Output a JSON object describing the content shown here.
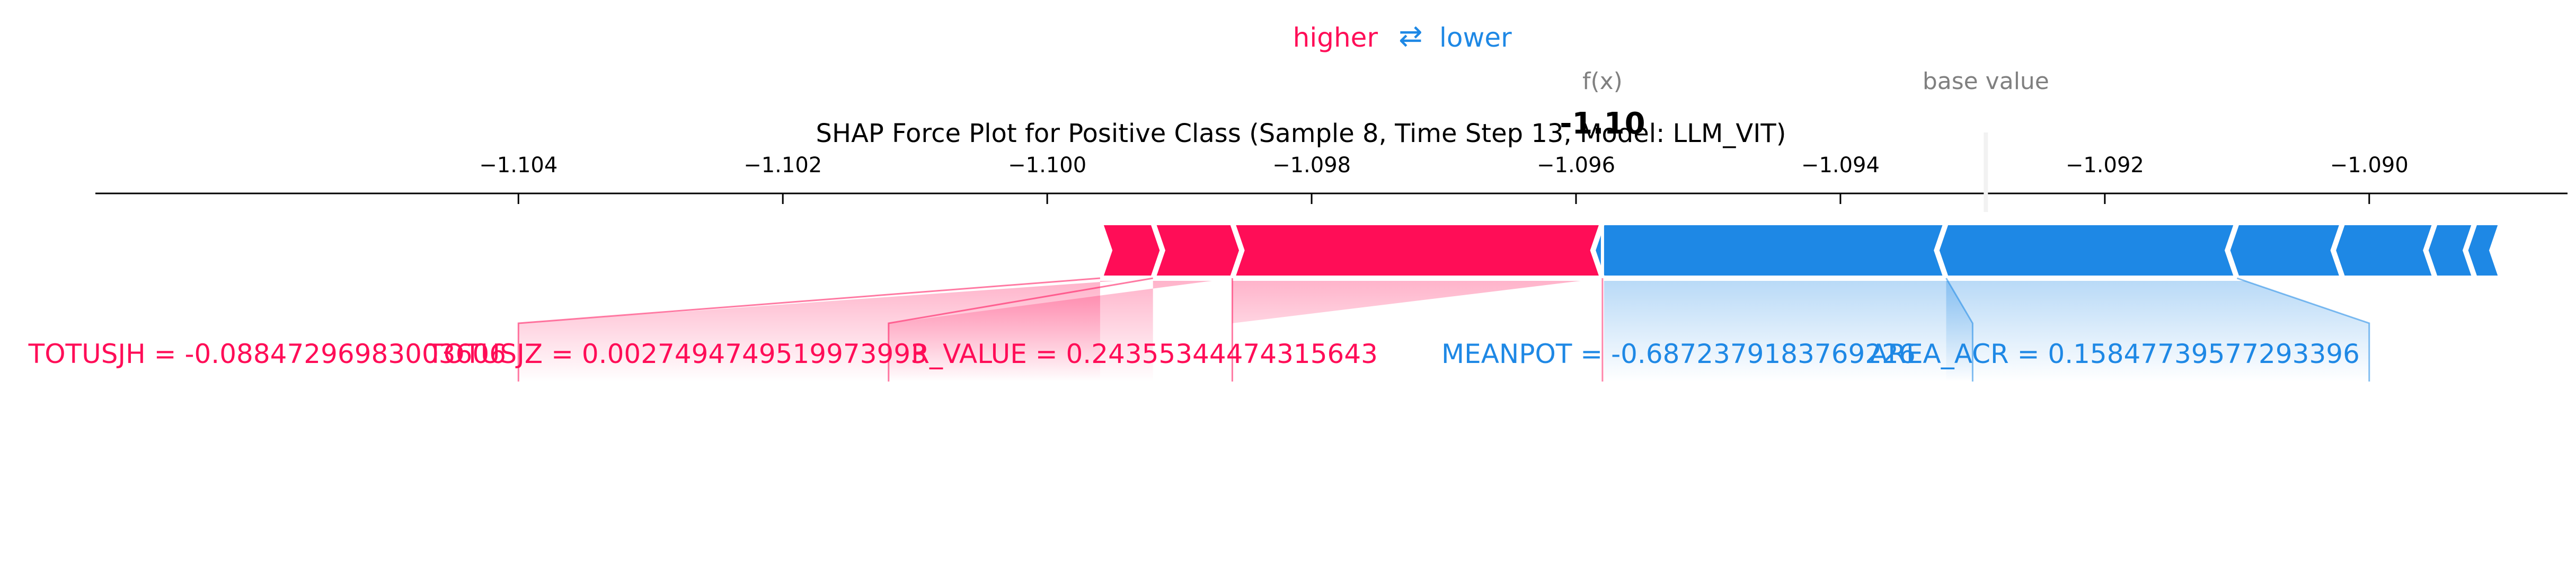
{
  "chart_data": {
    "type": "force",
    "title": "SHAP Force Plot for Positive Class (Sample 8, Time Step 13, Model: LLM_VIT)",
    "legend": {
      "higher": "higher",
      "arrow": "⇄",
      "lower": "lower"
    },
    "fx_label": "f(x)",
    "fx_value_text": "-1.10",
    "fx_value": -1.0958,
    "base_value_label": "base value",
    "base_value": -1.0929,
    "xlim": [
      -1.1072,
      -1.0885
    ],
    "ticks": [
      -1.104,
      -1.102,
      -1.1,
      -1.098,
      -1.096,
      -1.094,
      -1.092,
      -1.09
    ],
    "tick_labels": [
      "−1.104",
      "−1.102",
      "−1.100",
      "−1.098",
      "−1.096",
      "−1.094",
      "−1.092",
      "−1.090"
    ],
    "positive_features": [
      {
        "label": "TOTUSJH = -0.08847296983003606",
        "start": -1.0996,
        "end": -1.0992,
        "label_value": -1.104
      },
      {
        "label": "TOTUSJZ = 0.0027494749519973993",
        "start": -1.0992,
        "end": -1.0986,
        "label_value": -1.1012
      },
      {
        "label": "R_VALUE = 0.24355344474315643",
        "start": -1.0986,
        "end": -1.0958,
        "label_value": -1.0986
      }
    ],
    "negative_features": [
      {
        "label": "MEANPOT = -0.6872379183769226",
        "start": -1.0958,
        "end": -1.0932,
        "label_value": -1.093
      },
      {
        "label": "AREA_ACR = 0.15847739577293396",
        "start": -1.0932,
        "end": -1.091,
        "label_value": -1.09
      },
      {
        "label": "",
        "start": -1.091,
        "end": -1.0902,
        "label_value": null
      },
      {
        "label": "",
        "start": -1.0902,
        "end": -1.0895,
        "label_value": null
      },
      {
        "label": "",
        "start": -1.0895,
        "end": -1.0892,
        "label_value": null
      },
      {
        "label": "",
        "start": -1.0892,
        "end": -1.089,
        "label_value": null
      }
    ],
    "colors": {
      "positive": "#ff0d57",
      "negative": "#1e88e5",
      "muted": "#808080",
      "text": "#000000"
    }
  }
}
